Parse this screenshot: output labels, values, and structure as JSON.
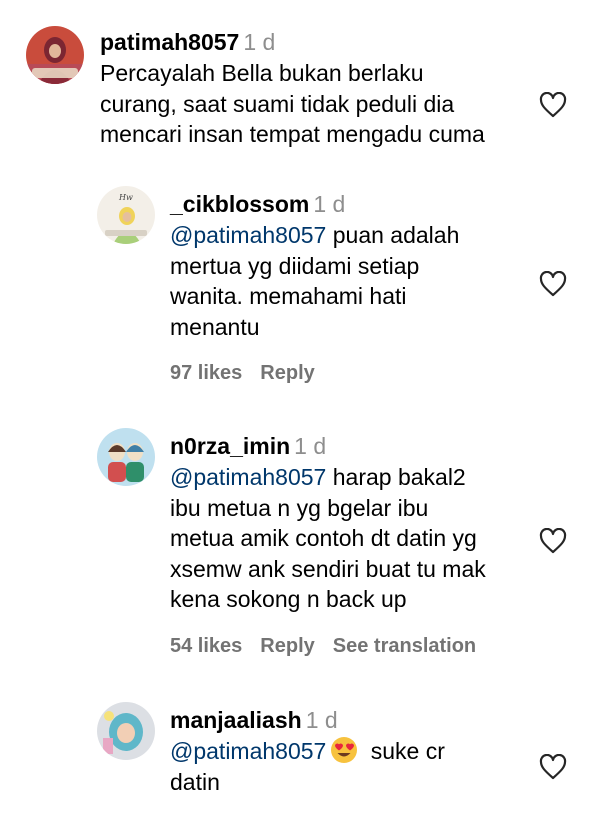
{
  "comments": [
    {
      "username": "patimah8057",
      "timestamp": "1 d",
      "lines": [
        "Percayalah Bella bukan berlaku",
        "curang, saat suami tidak peduli dia",
        "mencari insan tempat mengadu cuma"
      ]
    },
    {
      "username": "_cikblossom",
      "timestamp": "1 d",
      "mention": "@patimah8057",
      "first_line_rest": " puan adalah",
      "lines": [
        "mertua yg diidami setiap",
        "wanita. memahami hati",
        "menantu"
      ],
      "likes": "97 likes",
      "reply": "Reply"
    },
    {
      "username": "n0rza_imin",
      "timestamp": "1 d",
      "mention": "@patimah8057",
      "first_line_rest": " harap bakal2",
      "lines": [
        "ibu metua n yg bgelar ibu",
        "metua amik contoh dt datin yg",
        "xsemw ank sendiri buat tu mak",
        "kena sokong n back up"
      ],
      "likes": "54 likes",
      "reply": "Reply",
      "translation": "See translation"
    },
    {
      "username": "manjaaliash",
      "timestamp": "1 d",
      "mention": "@patimah8057",
      "emoji": "heart-eyes-emoji",
      "first_line_rest": " suke cr",
      "lines": [
        "datin"
      ]
    }
  ],
  "colors": {
    "text": "#000000",
    "secondary": "#8e8e8e",
    "meta": "#737373",
    "mention": "#00376b",
    "icon": "#262626"
  },
  "icons": {
    "like": "heart-outline-icon"
  }
}
